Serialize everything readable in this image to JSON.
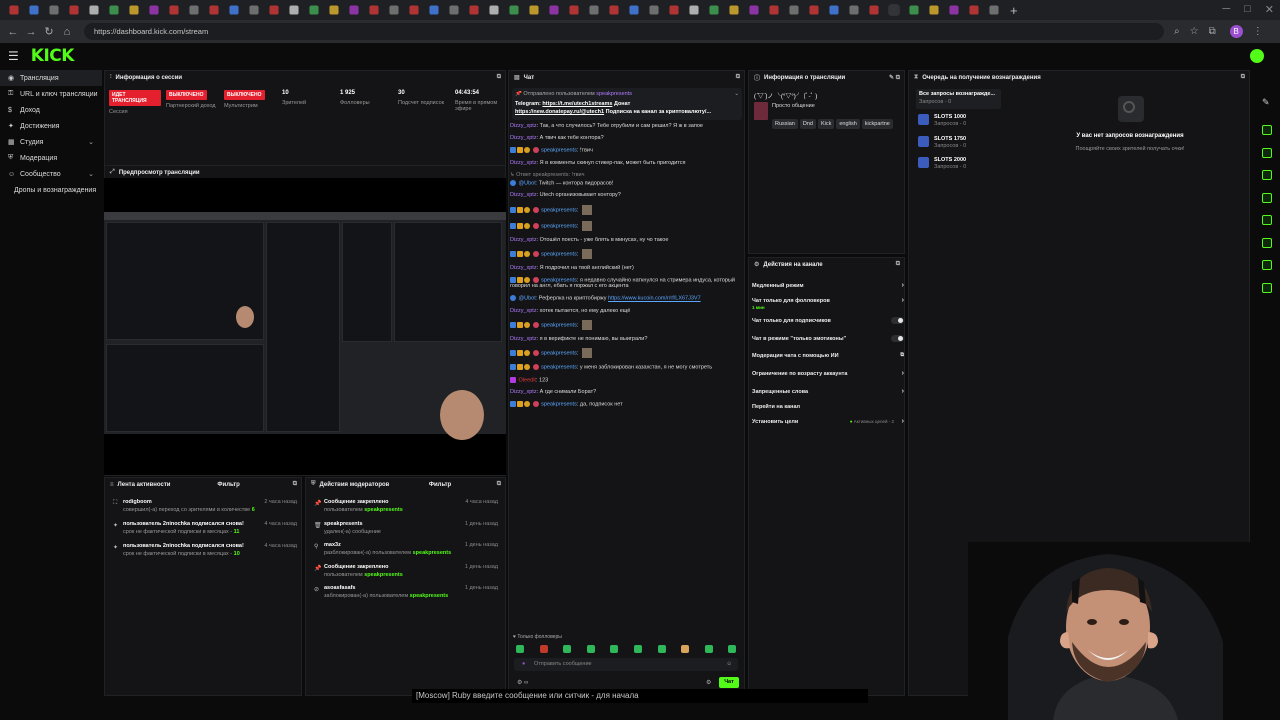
{
  "browser": {
    "url": "https://dashboard.kick.com/stream",
    "tab_count": 50,
    "new_tab_label": "+",
    "controls": [
      "─",
      "□",
      "✕"
    ],
    "profile_letter": "B"
  },
  "app": {
    "logo": "KICK",
    "accent": "#53fc18",
    "danger": "#e5202e"
  },
  "sidebar": {
    "items": [
      {
        "label": "Трансляция",
        "icon": "broadcast-icon",
        "active": true,
        "chevron": false
      },
      {
        "label": "URL и ключ трансляции",
        "icon": "key-icon",
        "active": false,
        "chevron": false
      },
      {
        "label": "Доход",
        "icon": "money-icon",
        "active": false,
        "chevron": false
      },
      {
        "label": "Достижения",
        "icon": "trophy-icon",
        "active": false,
        "chevron": false
      },
      {
        "label": "Студия",
        "icon": "studio-icon",
        "active": false,
        "chevron": true
      },
      {
        "label": "Модерация",
        "icon": "shield-icon",
        "active": false,
        "chevron": false
      },
      {
        "label": "Сообщество",
        "icon": "community-icon",
        "active": false,
        "chevron": true
      },
      {
        "label": "Дропы и вознаграждения",
        "icon": "",
        "active": false,
        "chevron": false
      }
    ]
  },
  "session": {
    "title": "Информация о сессии",
    "stats": [
      {
        "badge": "ИДЕТ ТРАНСЛЯЦИЯ",
        "label": "Сессия"
      },
      {
        "badge": "ВЫКЛЮЧЕНО",
        "label": "Партнерский доход"
      },
      {
        "badge": "ВЫКЛЮЧЕНО",
        "label": "Мультистрим"
      },
      {
        "value": "10",
        "label": "Зрителей"
      },
      {
        "value": "1 925",
        "label": "Фолловеры"
      },
      {
        "value": "30",
        "label": "Подсчет подписок"
      },
      {
        "value": "04:43:54",
        "label": "Время в прямом эфире"
      }
    ]
  },
  "preview": {
    "title": "Предпросмотр трансляции"
  },
  "activity": {
    "title": "Лента активности",
    "filter": "Фильтр",
    "events": [
      {
        "title": "rodigboom",
        "sub": "совершил(-а) переход со зрителями в количестве",
        "count": "6",
        "time": "2 часа назад"
      },
      {
        "title": "пользователь 2ninochka подписался снова!",
        "sub": "срок не фактической подписки в месяцах -",
        "count": "11",
        "time": "4 часа назад"
      },
      {
        "title": "пользователь 2ninochka подписался снова!",
        "sub": "срок не фактической подписки в месяцах -",
        "count": "10",
        "time": "4 часа назад"
      }
    ]
  },
  "modactions": {
    "title": "Действия модераторов",
    "filter": "Фильтр",
    "events": [
      {
        "title": "Сообщение закреплено",
        "pre": "пользователем",
        "user": "speakpresents",
        "time": "4 часа назад"
      },
      {
        "title": "speakpresents",
        "pre": "удален(-а) сообщение",
        "user": "",
        "time": "1 день назад"
      },
      {
        "title": "max3z",
        "pre": "разблокирован(-а) пользователем",
        "user": "speakpresents",
        "time": "1 день назад"
      },
      {
        "title": "Сообщение закреплено",
        "pre": "пользователем",
        "user": "speakpresents",
        "time": "1 день назад"
      },
      {
        "title": "asoasfasafs",
        "pre": "заблокирован(-а) пользователем",
        "user": "speakpresents",
        "time": "1 день назад"
      }
    ]
  },
  "chat": {
    "title": "Чат",
    "pinned_by": "Отправлено пользователем",
    "pinned_user": "speakpresents",
    "pinned_text_label": "Telegram:",
    "pinned_link1": "https://t.me/utech1streams",
    "pinned_donate": "Донат",
    "pinned_link2": "https://new.donatepay.ru/@utech1",
    "pinned_tail": "Подписка на канал за криптовалюту/...",
    "messages": [
      {
        "user": "Dizzy_xptz",
        "text": "Так, а что случилось? Тебе отрубили и сам решил? Я ж в запое"
      },
      {
        "user": "Dizzy_xptz",
        "text": "А твич как тебе контора?"
      },
      {
        "user": "speakpresents",
        "text": "!твич",
        "mod": true
      },
      {
        "user": "Dizzy_xptz",
        "text": "Я в комменты скинул стикер-пак, может быть пригодится"
      },
      {
        "reply": "Ответ speakpresents: !твич"
      },
      {
        "user": "@Ubot:",
        "text": "Twitch — контора пидорасов!",
        "bot": true
      },
      {
        "user": "Dizzy_xptz",
        "text": "Utech организовывает контору?"
      },
      {
        "user": "speakpresents",
        "text": "",
        "mod": true,
        "sticker": true
      },
      {
        "user": "speakpresents",
        "text": "",
        "mod": true,
        "sticker": true
      },
      {
        "user": "Dizzy_xptz",
        "text": "Отошёл поесть - уже блять в минусах, ну чо такое"
      },
      {
        "user": "speakpresents",
        "text": "",
        "mod": true,
        "sticker": true
      },
      {
        "user": "Dizzy_xptz",
        "text": "Я подрочил на твой английский (нет)"
      },
      {
        "user": "speakpresents",
        "text": "я недавно случайно наткнулся на стримера индуса, который говорил на англ, ебать я поржал с его акцента",
        "mod": true
      },
      {
        "user": "@Ubot:",
        "text": "Реферлка на криптобиржу",
        "link": "https://www.kucoin.com/r/rf/LX67J3V7",
        "bot": true
      },
      {
        "user": "Dizzy_xptz",
        "text": "хотек пытается, но ему далеко ещё"
      },
      {
        "user": "speakpresents",
        "text": "",
        "mod": true,
        "sticker": true
      },
      {
        "user": "Dizzy_xptz",
        "text": "я в верификте не понимаю, вы выиграли?"
      },
      {
        "user": "speakpresents",
        "text": "",
        "mod": true,
        "sticker": true
      },
      {
        "user": "speakpresents",
        "text": "у меня заблокирован казахстан, я не могу смотреть",
        "mod": true
      },
      {
        "user": "Oleedit",
        "text": "123",
        "red": true
      },
      {
        "user": "Dizzy_xptz",
        "text": "А где снимали Борат?"
      },
      {
        "user": "speakpresents",
        "text": "да, подписок нет",
        "mod": true
      }
    ],
    "followers_only": "Только фолловеры",
    "input_placeholder": "Отправить сообщение",
    "send_label": "Чат"
  },
  "streaminfo": {
    "title": "Информация о трансляции",
    "stream_title": "( ̄▽ ̄)ノ ╰(°▽°)╯ (ﾟ-ﾟ )",
    "category": "Просто общение",
    "tags": [
      "Russian",
      "Dnd",
      "Kick",
      "english",
      "kickpartne"
    ]
  },
  "rewards": {
    "title": "Очередь на получение вознаграждения",
    "dropdown": "Все запросы вознагражде...",
    "dropdown_sub": "Запросов - 0",
    "items": [
      {
        "name": "SLOTS 1000",
        "sub": "Запросов - 0"
      },
      {
        "name": "SLOTS 1750",
        "sub": "Запросов - 0"
      },
      {
        "name": "SLOTS 2000",
        "sub": "Запросов - 0"
      }
    ],
    "empty_title": "У вас нет запросов вознаграждения",
    "empty_sub": "Поощряйте своих зрителей получать очки!"
  },
  "channelactions": {
    "title": "Действия на канале",
    "items": [
      {
        "label": "Медленный режим",
        "type": "arrow"
      },
      {
        "label": "Чат только для фолловеров",
        "type": "arrow",
        "sub": "1 мин"
      },
      {
        "label": "Чат только для подписчиков",
        "type": "toggle"
      },
      {
        "label": "Чат в режиме \"только эмотиконы\"",
        "type": "toggle"
      },
      {
        "label": "Модерация чата с помощью ИИ",
        "type": "external"
      },
      {
        "label": "Ограничение по возрасту аккаунта",
        "type": "arrow"
      },
      {
        "label": "Запрещенные слова",
        "type": "arrow"
      },
      {
        "label": "Перейти на канал",
        "type": "none"
      },
      {
        "label": "Установить цели",
        "type": "arrow",
        "extra": "Активных целей - 2"
      }
    ]
  },
  "caption": "[Moscow] Ruby введите сообщение или ситчик - для начала"
}
